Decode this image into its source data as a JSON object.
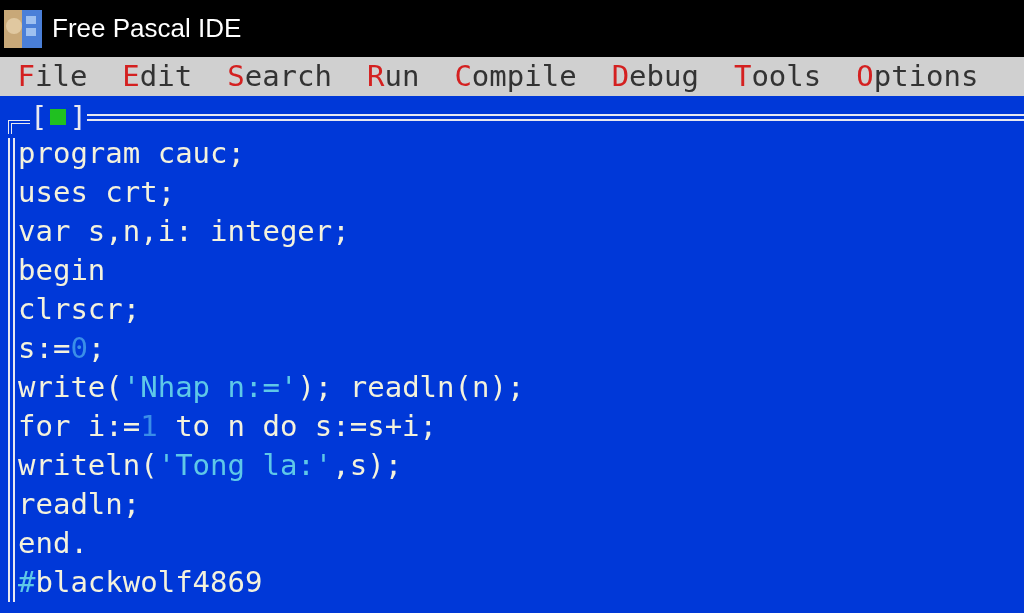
{
  "window": {
    "title": "Free Pascal IDE"
  },
  "menu": [
    {
      "hotkey": "F",
      "rest": "ile"
    },
    {
      "hotkey": "E",
      "rest": "dit"
    },
    {
      "hotkey": "S",
      "rest": "earch"
    },
    {
      "hotkey": "R",
      "rest": "un"
    },
    {
      "hotkey": "C",
      "rest": "ompile"
    },
    {
      "hotkey": "D",
      "rest": "ebug"
    },
    {
      "hotkey": "T",
      "rest": "ools"
    },
    {
      "hotkey": "O",
      "rest": "ptions"
    }
  ],
  "editor": {
    "close_box": {
      "open": "[",
      "close": "]"
    },
    "lines": [
      [
        {
          "kind": "plain",
          "text": "program cauc;"
        }
      ],
      [
        {
          "kind": "plain",
          "text": "uses crt;"
        }
      ],
      [
        {
          "kind": "plain",
          "text": "var s,n,i: integer;"
        }
      ],
      [
        {
          "kind": "plain",
          "text": "begin"
        }
      ],
      [
        {
          "kind": "plain",
          "text": "clrscr;"
        }
      ],
      [
        {
          "kind": "plain",
          "text": "s:="
        },
        {
          "kind": "number",
          "text": "0"
        },
        {
          "kind": "plain",
          "text": ";"
        }
      ],
      [
        {
          "kind": "plain",
          "text": "write("
        },
        {
          "kind": "string",
          "text": "'Nhap n:='"
        },
        {
          "kind": "plain",
          "text": "); readln(n);"
        }
      ],
      [
        {
          "kind": "plain",
          "text": "for i:="
        },
        {
          "kind": "number",
          "text": "1"
        },
        {
          "kind": "plain",
          "text": " to n do s:=s+i;"
        }
      ],
      [
        {
          "kind": "plain",
          "text": "writeln("
        },
        {
          "kind": "string",
          "text": "'Tong la:'"
        },
        {
          "kind": "plain",
          "text": ",s);"
        }
      ],
      [
        {
          "kind": "plain",
          "text": "readln;"
        }
      ],
      [
        {
          "kind": "plain",
          "text": "end."
        }
      ],
      [
        {
          "kind": "string",
          "text": "#"
        },
        {
          "kind": "plain",
          "text": "blackwolf4869"
        }
      ]
    ]
  }
}
